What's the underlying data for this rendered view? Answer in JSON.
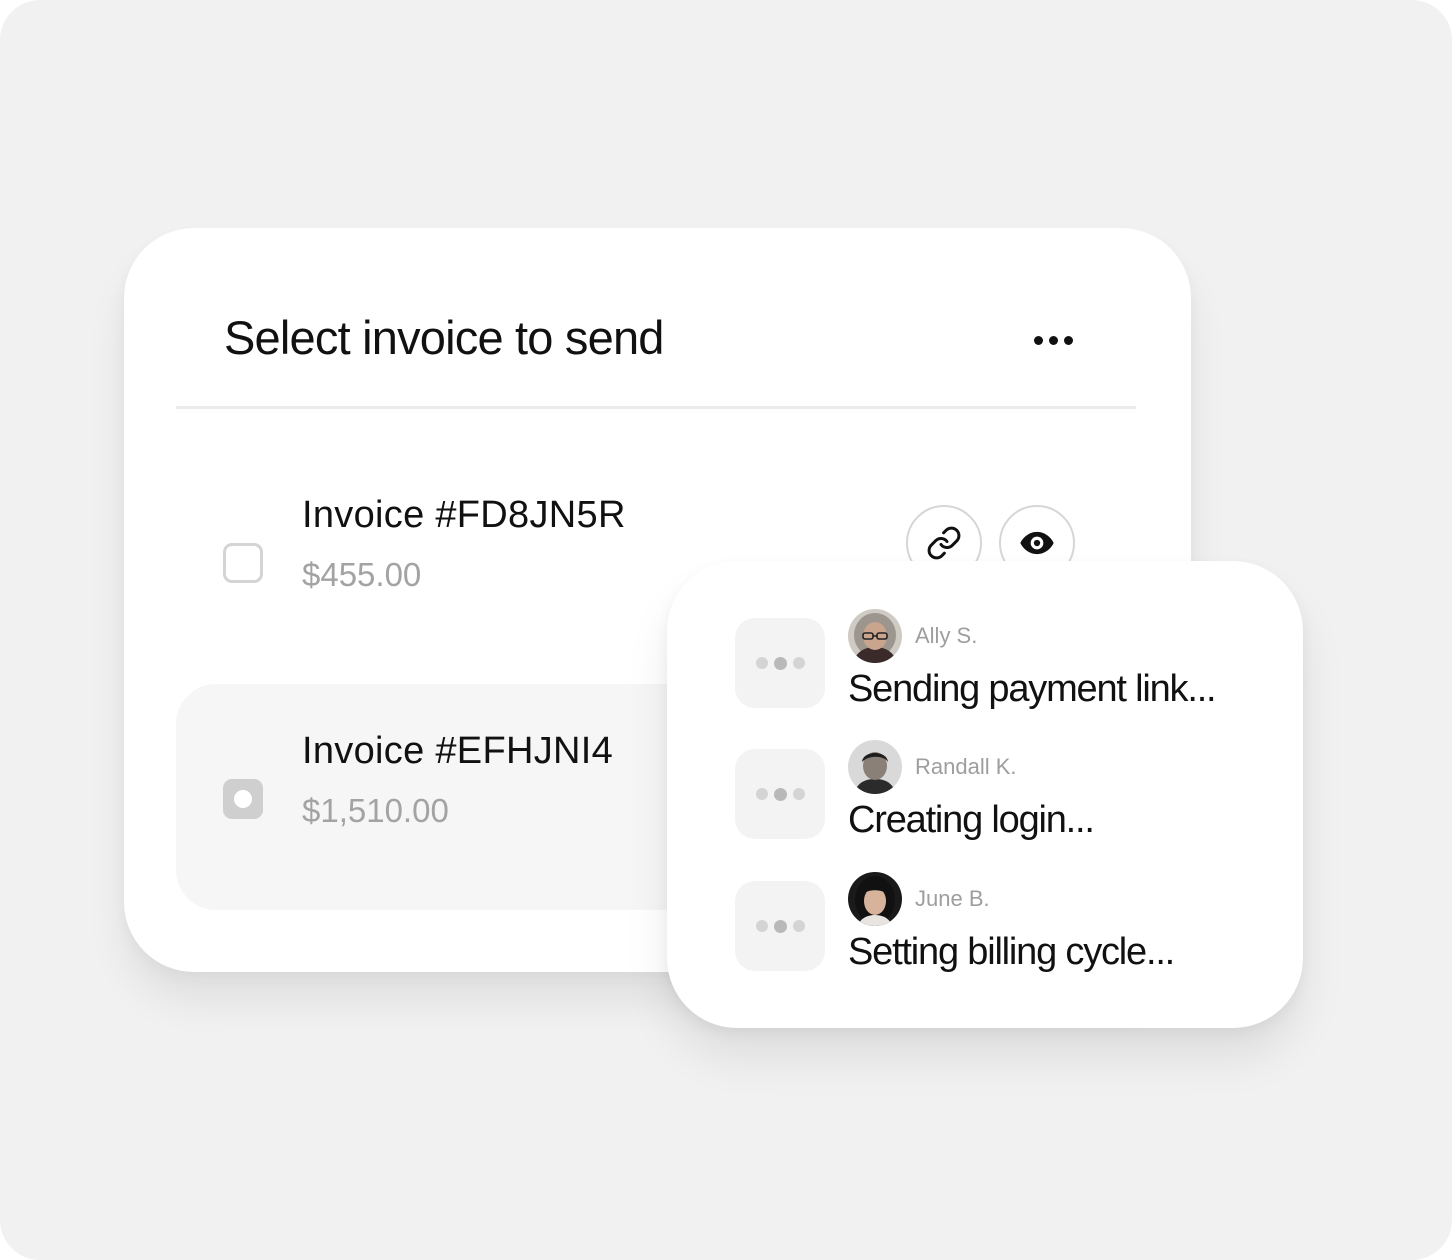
{
  "invoice_picker": {
    "title": "Select invoice to send",
    "more_icon": "more-horizontal-icon",
    "invoices": [
      {
        "title": "Invoice #FD8JN5R",
        "amount": "$455.00",
        "checked": false,
        "actions": [
          "link-icon",
          "eye-icon"
        ]
      },
      {
        "title": "Invoice #EFHJNI4",
        "amount": "$1,510.00",
        "checked": true
      }
    ]
  },
  "activity": {
    "items": [
      {
        "name": "Ally S.",
        "status": "Sending payment link..."
      },
      {
        "name": "Randall K.",
        "status": "Creating login..."
      },
      {
        "name": "June B.",
        "status": "Setting billing cycle..."
      }
    ]
  },
  "colors": {
    "background": "#f1f1f1",
    "card": "#ffffff",
    "text_primary": "#111111",
    "text_muted": "#a3a3a3",
    "selected_row": "#f6f6f6"
  }
}
